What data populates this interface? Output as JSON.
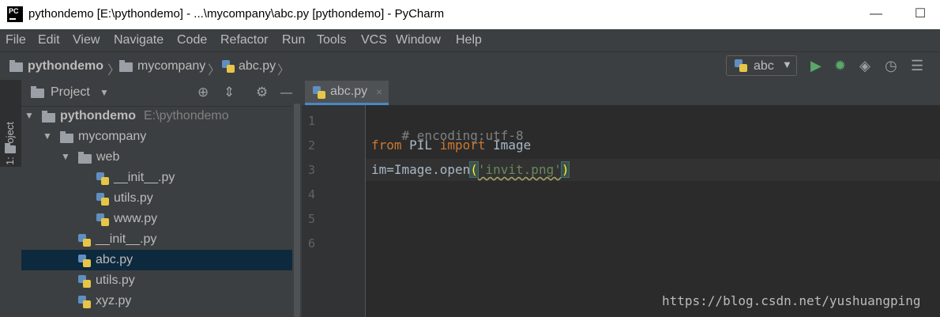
{
  "window": {
    "title": "pythondemo [E:\\pythondemo] - ...\\mycompany\\abc.py [pythondemo] - PyCharm",
    "app_icon_text": "PC",
    "minimize_glyph": "—",
    "maximize_glyph": "☐"
  },
  "menu": [
    "File",
    "Edit",
    "View",
    "Navigate",
    "Code",
    "Refactor",
    "Run",
    "Tools",
    "VCS",
    "Window",
    "Help"
  ],
  "breadcrumb": [
    "pythondemo",
    "mycompany",
    "abc.py"
  ],
  "breadcrumb_sep": "〉",
  "run_config": {
    "label": "abc",
    "arrow": "▼"
  },
  "toolbar_icons": [
    "run-icon",
    "debug-icon",
    "coverage-icon",
    "profile-icon",
    "build-icon"
  ],
  "side_tab": {
    "label": "1: Project"
  },
  "project_panel": {
    "title": "Project",
    "dropdown": "▼",
    "tree": [
      {
        "name": "pythondemo",
        "path": "E:\\pythondemo",
        "type": "folder",
        "expanded": true
      },
      {
        "name": "mycompany",
        "type": "package",
        "expanded": true
      },
      {
        "name": "web",
        "type": "package",
        "expanded": true
      },
      {
        "name": "__init__.py",
        "type": "py"
      },
      {
        "name": "utils.py",
        "type": "py"
      },
      {
        "name": "www.py",
        "type": "py"
      },
      {
        "name": "__init__.py",
        "type": "py"
      },
      {
        "name": "abc.py",
        "type": "py",
        "selected": true
      },
      {
        "name": "utils.py",
        "type": "py"
      },
      {
        "name": "xyz.py",
        "type": "py"
      }
    ]
  },
  "editor": {
    "tab": {
      "label": "abc.py",
      "close": "×"
    },
    "line_numbers": [
      "1",
      "2",
      "3",
      "4",
      "5",
      "6"
    ],
    "lines": {
      "l1": "# encoding:utf-8",
      "l2_from": "from",
      "l2_mod": " PIL ",
      "l2_import": "import",
      "l2_name": " Image",
      "l3_pre": "im=Image.open",
      "l3_open": "(",
      "l3_str": "'invit.png'",
      "l3_close": ")"
    }
  },
  "watermark": "https://blog.csdn.net/yushuangping",
  "colors": {
    "keyword": "#cc7832",
    "comment": "#808080",
    "string": "#6a8759",
    "selection": "#0d293e",
    "tab_underline": "#4a88c7"
  }
}
